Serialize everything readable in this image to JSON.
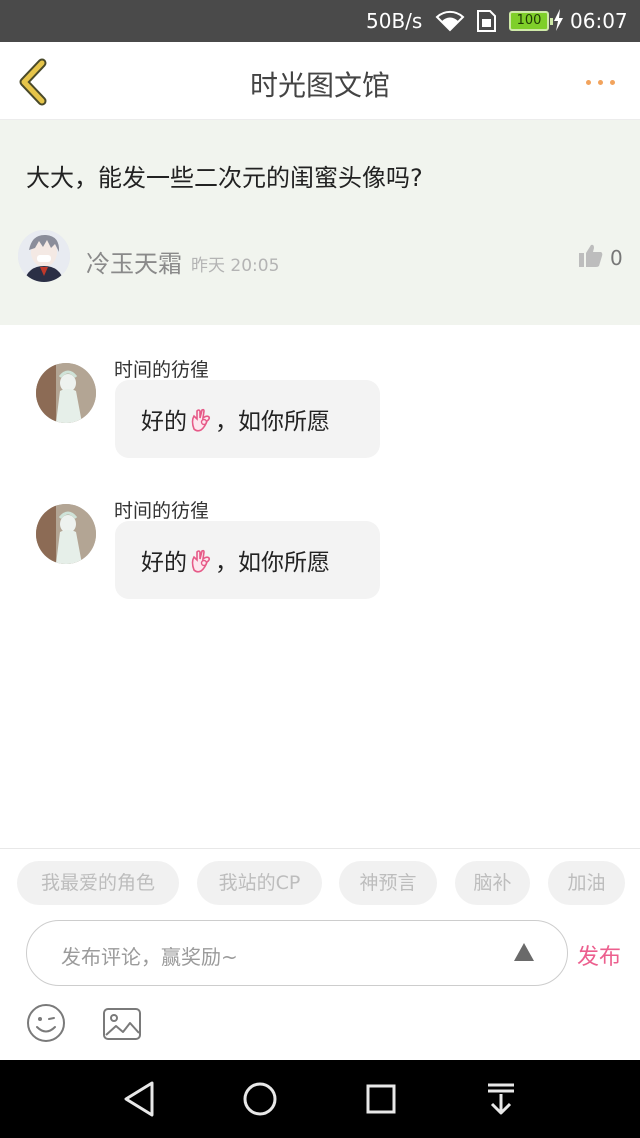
{
  "status_bar": {
    "net_speed": "50B/s",
    "battery": "100",
    "time": "06:07",
    "icons": [
      "wifi-icon",
      "sim-icon",
      "battery-icon",
      "charging-icon"
    ]
  },
  "header": {
    "title": "时光图文馆",
    "back_icon": "chevron-left-icon",
    "more_icon": "more-dots-icon"
  },
  "post": {
    "text": "大大，能发一些二次元的闺蜜头像吗?",
    "author": "冷玉天霜",
    "time": "昨天 20:05",
    "likes": "0",
    "like_icon": "thumbs-up-icon"
  },
  "comments": [
    {
      "name": "时间的彷徨",
      "text_before": "好的",
      "text_after": "，如你所愿",
      "emoji": "ok-hand-icon"
    },
    {
      "name": "时间的彷徨",
      "text_before": "好的",
      "text_after": "，如你所愿",
      "emoji": "ok-hand-icon"
    }
  ],
  "quick_tags": [
    "我最爱的角色",
    "我站的CP",
    "神预言",
    "脑补",
    "加油"
  ],
  "input": {
    "placeholder": "发布评论，赢奖励~",
    "publish_label": "发布"
  },
  "toolbar_icons": [
    "smiley-icon",
    "image-icon"
  ],
  "nav_icons": [
    "back-triangle-icon",
    "home-circle-icon",
    "recents-square-icon",
    "notification-pull-icon"
  ],
  "colors": {
    "accent_pink": "#ec5f8e",
    "accent_orange": "#f2a35c",
    "post_bg": "#f1f4ee",
    "back_arrow": "#e6c54a"
  }
}
